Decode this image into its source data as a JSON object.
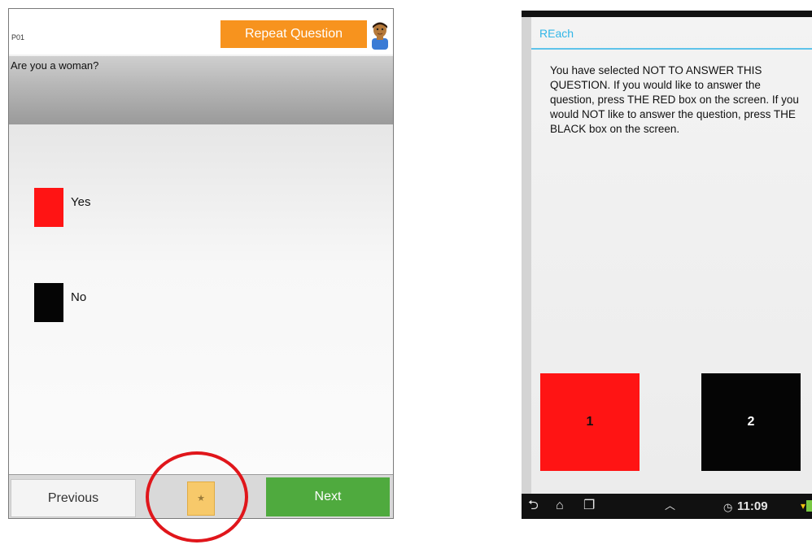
{
  "left_screen": {
    "question_id": "P01",
    "repeat_button_label": "Repeat Question",
    "question_text": "Are you a woman?",
    "answers": [
      {
        "label": "Yes",
        "color": "#ff1414"
      },
      {
        "label": "No",
        "color": "#050505"
      }
    ],
    "previous_label": "Previous",
    "star_label": "★",
    "next_label": "Next",
    "colors": {
      "repeat": "#f7931e",
      "next": "#4faa3e",
      "star": "#f7c96a",
      "highlight": "#e0161b"
    }
  },
  "right_screen": {
    "dialog_title": "REach",
    "message": "You have selected NOT TO ANSWER THIS QUESTION. If you would like to answer the question, press THE RED box on the screen. If you would NOT like to answer the question, press THE BLACK box on the screen.",
    "choices": [
      {
        "label": "1",
        "color": "#ff1414"
      },
      {
        "label": "2",
        "color": "#050505"
      }
    ],
    "status_time": "11:09",
    "colors": {
      "title": "#31b6e7"
    }
  },
  "icons": [
    "avatar-icon",
    "back-icon",
    "home-icon",
    "recent-apps-icon",
    "up-chevron-icon",
    "clock-icon",
    "signal-icon",
    "battery-icon"
  ]
}
